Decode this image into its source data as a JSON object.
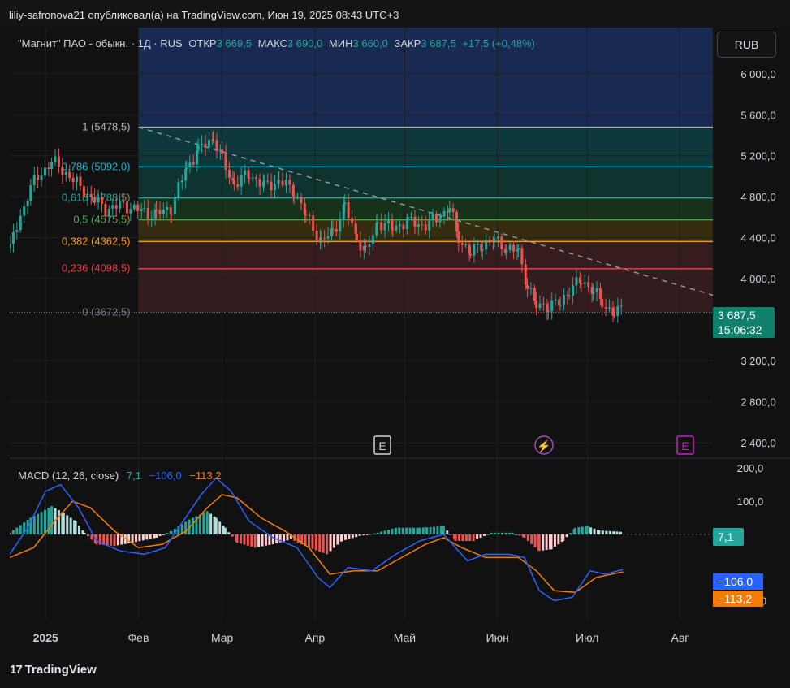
{
  "header": {
    "text": "liliy-safronova21 опубликовал(а) на TradingView.com, Июн 19, 2025 08:43 UTC+3"
  },
  "toolbar": {
    "currency_label": "RUB"
  },
  "legend": {
    "symbol": "\"Магнит\" ПАО - обыкн. · 1Д · RUS",
    "open_label": "ОТКР",
    "open_value": "3 669,5",
    "high_label": "МАКС",
    "high_value": "3 690,0",
    "low_label": "МИН",
    "low_value": "3 660,0",
    "close_label": "ЗАКР",
    "close_value": "3 687,5",
    "change": "+17,5 (+0,48%)"
  },
  "price_badge": {
    "price": "3 687,5",
    "countdown": "15:06:32"
  },
  "macd_legend": {
    "label": "MACD (12, 26, close)",
    "hist": "7,1",
    "macd": "−106,0",
    "signal": "−113,2"
  },
  "macd_badges": {
    "hist": "7,1",
    "macd": "−106,0",
    "signal": "−113,2"
  },
  "events": [
    {
      "label": "E",
      "icon": "earnings-icon",
      "color": "#d1d4dc"
    },
    {
      "label": "⚡",
      "icon": "dividend-bolt-icon",
      "color": "#ab47bc"
    },
    {
      "label": "E",
      "icon": "earnings-icon",
      "color": "#c71bd2"
    }
  ],
  "footer": {
    "logo_mark": "17",
    "logo_text": "TradingView"
  },
  "chart_data": [
    {
      "type": "candlestick",
      "series_name": "\"Магнит\" ПАО - обыкн.",
      "ylim": [
        2250,
        6450
      ],
      "y_ticks": [
        {
          "value": 2400,
          "label": "2 400,0"
        },
        {
          "value": 2800,
          "label": "2 800,0"
        },
        {
          "value": 3200,
          "label": "3 200,0"
        },
        {
          "value": 4000,
          "label": "4 000,0"
        },
        {
          "value": 4400,
          "label": "4 400,0"
        },
        {
          "value": 4800,
          "label": "4 800,0"
        },
        {
          "value": 5200,
          "label": "5 200,0"
        },
        {
          "value": 5600,
          "label": "5 600,0"
        },
        {
          "value": 6000,
          "label": "6 000,0"
        }
      ],
      "x_labels": [
        {
          "date": "2025-01-01",
          "label": "2025",
          "bold": true
        },
        {
          "date": "2025-02-01",
          "label": "Фев"
        },
        {
          "date": "2025-03-01",
          "label": "Мар"
        },
        {
          "date": "2025-04-01",
          "label": "Апр"
        },
        {
          "date": "2025-05-01",
          "label": "Май"
        },
        {
          "date": "2025-06-01",
          "label": "Июн"
        },
        {
          "date": "2025-07-01",
          "label": "Июл"
        },
        {
          "date": "2025-08-01",
          "label": "Авг"
        }
      ],
      "x_range": [
        "2024-12-20",
        "2025-08-12"
      ],
      "fib_levels": [
        {
          "level": "1",
          "value": 5478.5,
          "label": "1 (5478,5)",
          "color": "#b2b5be",
          "fill": "#3a3a3a"
        },
        {
          "level": "0.786",
          "value": 5092.0,
          "label": "0,786 (5092,0)",
          "color": "#00bcd4",
          "fill": "#0d3f44"
        },
        {
          "level": "0.618",
          "value": 4788.5,
          "label": "0,618 (4788,5)",
          "color": "#26a69a",
          "fill": "#0f3a35"
        },
        {
          "level": "0.5",
          "value": 4575.5,
          "label": "0,5 (4575,5)",
          "color": "#4caf50",
          "fill": "#17381d"
        },
        {
          "level": "0.382",
          "value": 4362.5,
          "label": "0,382 (4362,5)",
          "color": "#ff9800",
          "fill": "#3d3312"
        },
        {
          "level": "0.236",
          "value": 4098.5,
          "label": "0,236 (4098,5)",
          "color": "#f23645",
          "fill": "#3d1e20"
        },
        {
          "level": "0",
          "value": 3672.5,
          "label": "0 (3672,5)",
          "color": "#787b86",
          "fill": "#3a1d21"
        }
      ],
      "fib_extension_fill": "#1a2d5a",
      "fib_start_date": "2025-02-01",
      "trendline": {
        "from": {
          "date": "2025-02-01",
          "value": 5478.5
        },
        "to": {
          "date": "2025-08-12",
          "value": 3840
        }
      },
      "anchors": [
        {
          "date": "2024-12-20",
          "value": 4300
        },
        {
          "date": "2024-12-27",
          "value": 4900
        },
        {
          "date": "2025-01-03",
          "value": 5150
        },
        {
          "date": "2025-01-09",
          "value": 5000
        },
        {
          "date": "2025-01-15",
          "value": 4820
        },
        {
          "date": "2025-01-21",
          "value": 4680
        },
        {
          "date": "2025-01-27",
          "value": 4720
        },
        {
          "date": "2025-02-03",
          "value": 4650
        },
        {
          "date": "2025-02-07",
          "value": 4620
        },
        {
          "date": "2025-02-12",
          "value": 4700
        },
        {
          "date": "2025-02-17",
          "value": 5080
        },
        {
          "date": "2025-02-21",
          "value": 5250
        },
        {
          "date": "2025-02-26",
          "value": 5380
        },
        {
          "date": "2025-03-01",
          "value": 5150
        },
        {
          "date": "2025-03-05",
          "value": 4920
        },
        {
          "date": "2025-03-10",
          "value": 5030
        },
        {
          "date": "2025-03-15",
          "value": 4900
        },
        {
          "date": "2025-03-20",
          "value": 4950
        },
        {
          "date": "2025-03-25",
          "value": 4870
        },
        {
          "date": "2025-03-29",
          "value": 4620
        },
        {
          "date": "2025-04-03",
          "value": 4360
        },
        {
          "date": "2025-04-07",
          "value": 4450
        },
        {
          "date": "2025-04-11",
          "value": 4700
        },
        {
          "date": "2025-04-15",
          "value": 4400
        },
        {
          "date": "2025-04-18",
          "value": 4250
        },
        {
          "date": "2025-04-22",
          "value": 4550
        },
        {
          "date": "2025-04-27",
          "value": 4500
        },
        {
          "date": "2025-05-02",
          "value": 4560
        },
        {
          "date": "2025-05-08",
          "value": 4520
        },
        {
          "date": "2025-05-13",
          "value": 4620
        },
        {
          "date": "2025-05-16",
          "value": 4700
        },
        {
          "date": "2025-05-19",
          "value": 4400
        },
        {
          "date": "2025-05-23",
          "value": 4250
        },
        {
          "date": "2025-05-27",
          "value": 4350
        },
        {
          "date": "2025-05-31",
          "value": 4380
        },
        {
          "date": "2025-06-04",
          "value": 4300
        },
        {
          "date": "2025-06-08",
          "value": 4260
        },
        {
          "date": "2025-06-11",
          "value": 3950
        },
        {
          "date": "2025-06-14",
          "value": 3730
        },
        {
          "date": "2025-06-18",
          "value": 3750
        },
        {
          "date": "2025-06-22",
          "value": 3760
        },
        {
          "date": "2025-06-25",
          "value": 3900
        },
        {
          "date": "2025-06-29",
          "value": 3980
        },
        {
          "date": "2025-07-03",
          "value": 3900
        },
        {
          "date": "2025-07-06",
          "value": 3750
        },
        {
          "date": "2025-07-10",
          "value": 3680
        },
        {
          "date": "2025-07-13",
          "value": 3687.5
        }
      ],
      "colors": {
        "up": "#26a69a",
        "down": "#ef5350"
      }
    },
    {
      "type": "macd",
      "params": "12, 26, close",
      "ylim": [
        -260,
        230
      ],
      "y_ticks": [
        {
          "value": 200,
          "label": "200,0"
        },
        {
          "value": 100,
          "label": "100,0"
        },
        {
          "value": -200,
          "label": "−200,0"
        }
      ],
      "macd_line": [
        {
          "date": "2024-12-20",
          "value": -60
        },
        {
          "date": "2024-12-26",
          "value": 20
        },
        {
          "date": "2025-01-01",
          "value": 130
        },
        {
          "date": "2025-01-06",
          "value": 150
        },
        {
          "date": "2025-01-12",
          "value": 80
        },
        {
          "date": "2025-01-18",
          "value": -20
        },
        {
          "date": "2025-01-26",
          "value": -50
        },
        {
          "date": "2025-02-03",
          "value": -60
        },
        {
          "date": "2025-02-10",
          "value": -40
        },
        {
          "date": "2025-02-16",
          "value": 40
        },
        {
          "date": "2025-02-22",
          "value": 120
        },
        {
          "date": "2025-02-27",
          "value": 170
        },
        {
          "date": "2025-03-04",
          "value": 130
        },
        {
          "date": "2025-03-10",
          "value": 40
        },
        {
          "date": "2025-03-18",
          "value": -10
        },
        {
          "date": "2025-03-26",
          "value": -40
        },
        {
          "date": "2025-04-02",
          "value": -130
        },
        {
          "date": "2025-04-06",
          "value": -160
        },
        {
          "date": "2025-04-12",
          "value": -100
        },
        {
          "date": "2025-04-20",
          "value": -110
        },
        {
          "date": "2025-04-28",
          "value": -60
        },
        {
          "date": "2025-05-06",
          "value": -20
        },
        {
          "date": "2025-05-14",
          "value": 0
        },
        {
          "date": "2025-05-16",
          "value": -20
        },
        {
          "date": "2025-05-22",
          "value": -80
        },
        {
          "date": "2025-05-28",
          "value": -60
        },
        {
          "date": "2025-06-05",
          "value": -60
        },
        {
          "date": "2025-06-10",
          "value": -70
        },
        {
          "date": "2025-06-15",
          "value": -170
        },
        {
          "date": "2025-06-20",
          "value": -200
        },
        {
          "date": "2025-06-26",
          "value": -190
        },
        {
          "date": "2025-07-02",
          "value": -110
        },
        {
          "date": "2025-07-07",
          "value": -120
        },
        {
          "date": "2025-07-13",
          "value": -106
        }
      ],
      "signal_line": [
        {
          "date": "2024-12-20",
          "value": -70
        },
        {
          "date": "2024-12-28",
          "value": -40
        },
        {
          "date": "2025-01-04",
          "value": 40
        },
        {
          "date": "2025-01-10",
          "value": 100
        },
        {
          "date": "2025-01-16",
          "value": 80
        },
        {
          "date": "2025-01-24",
          "value": 10
        },
        {
          "date": "2025-02-01",
          "value": -40
        },
        {
          "date": "2025-02-09",
          "value": -30
        },
        {
          "date": "2025-02-17",
          "value": 10
        },
        {
          "date": "2025-02-24",
          "value": 80
        },
        {
          "date": "2025-03-01",
          "value": 120
        },
        {
          "date": "2025-03-06",
          "value": 110
        },
        {
          "date": "2025-03-14",
          "value": 50
        },
        {
          "date": "2025-03-22",
          "value": 10
        },
        {
          "date": "2025-03-30",
          "value": -40
        },
        {
          "date": "2025-04-06",
          "value": -120
        },
        {
          "date": "2025-04-14",
          "value": -110
        },
        {
          "date": "2025-04-22",
          "value": -110
        },
        {
          "date": "2025-04-30",
          "value": -70
        },
        {
          "date": "2025-05-08",
          "value": -30
        },
        {
          "date": "2025-05-14",
          "value": -10
        },
        {
          "date": "2025-05-20",
          "value": -40
        },
        {
          "date": "2025-05-28",
          "value": -70
        },
        {
          "date": "2025-06-08",
          "value": -70
        },
        {
          "date": "2025-06-14",
          "value": -110
        },
        {
          "date": "2025-06-20",
          "value": -170
        },
        {
          "date": "2025-06-27",
          "value": -175
        },
        {
          "date": "2025-07-04",
          "value": -130
        },
        {
          "date": "2025-07-13",
          "value": -113
        }
      ],
      "histogram": [
        {
          "date": "2024-12-20",
          "value": 5
        },
        {
          "date": "2024-12-27",
          "value": 50
        },
        {
          "date": "2025-01-03",
          "value": 85
        },
        {
          "date": "2025-01-07",
          "value": 65
        },
        {
          "date": "2025-01-11",
          "value": 40
        },
        {
          "date": "2025-01-14",
          "value": 5
        },
        {
          "date": "2025-01-18",
          "value": -30
        },
        {
          "date": "2025-01-24",
          "value": -35
        },
        {
          "date": "2025-01-30",
          "value": -25
        },
        {
          "date": "2025-02-07",
          "value": -10
        },
        {
          "date": "2025-02-12",
          "value": 10
        },
        {
          "date": "2025-02-18",
          "value": 45
        },
        {
          "date": "2025-02-24",
          "value": 70
        },
        {
          "date": "2025-02-27",
          "value": 50
        },
        {
          "date": "2025-03-02",
          "value": 20
        },
        {
          "date": "2025-03-06",
          "value": -25
        },
        {
          "date": "2025-03-12",
          "value": -40
        },
        {
          "date": "2025-03-18",
          "value": -30
        },
        {
          "date": "2025-03-24",
          "value": -15
        },
        {
          "date": "2025-03-30",
          "value": -40
        },
        {
          "date": "2025-04-05",
          "value": -60
        },
        {
          "date": "2025-04-10",
          "value": -20
        },
        {
          "date": "2025-04-16",
          "value": -5
        },
        {
          "date": "2025-04-22",
          "value": 5
        },
        {
          "date": "2025-04-28",
          "value": 20
        },
        {
          "date": "2025-05-06",
          "value": 20
        },
        {
          "date": "2025-05-14",
          "value": 25
        },
        {
          "date": "2025-05-18",
          "value": -20
        },
        {
          "date": "2025-05-24",
          "value": -20
        },
        {
          "date": "2025-05-30",
          "value": 5
        },
        {
          "date": "2025-06-06",
          "value": 5
        },
        {
          "date": "2025-06-10",
          "value": -10
        },
        {
          "date": "2025-06-15",
          "value": -50
        },
        {
          "date": "2025-06-19",
          "value": -45
        },
        {
          "date": "2025-06-23",
          "value": -20
        },
        {
          "date": "2025-06-27",
          "value": 20
        },
        {
          "date": "2025-07-01",
          "value": 25
        },
        {
          "date": "2025-07-05",
          "value": 12
        },
        {
          "date": "2025-07-13",
          "value": 7.1
        }
      ],
      "colors": {
        "macd": "#2962ff",
        "signal": "#f57c00",
        "hist_up_strong": "#26a69a",
        "hist_up_weak": "#b2dfdb",
        "hist_down_strong": "#ef5350",
        "hist_down_weak": "#ffcdd2"
      }
    }
  ]
}
